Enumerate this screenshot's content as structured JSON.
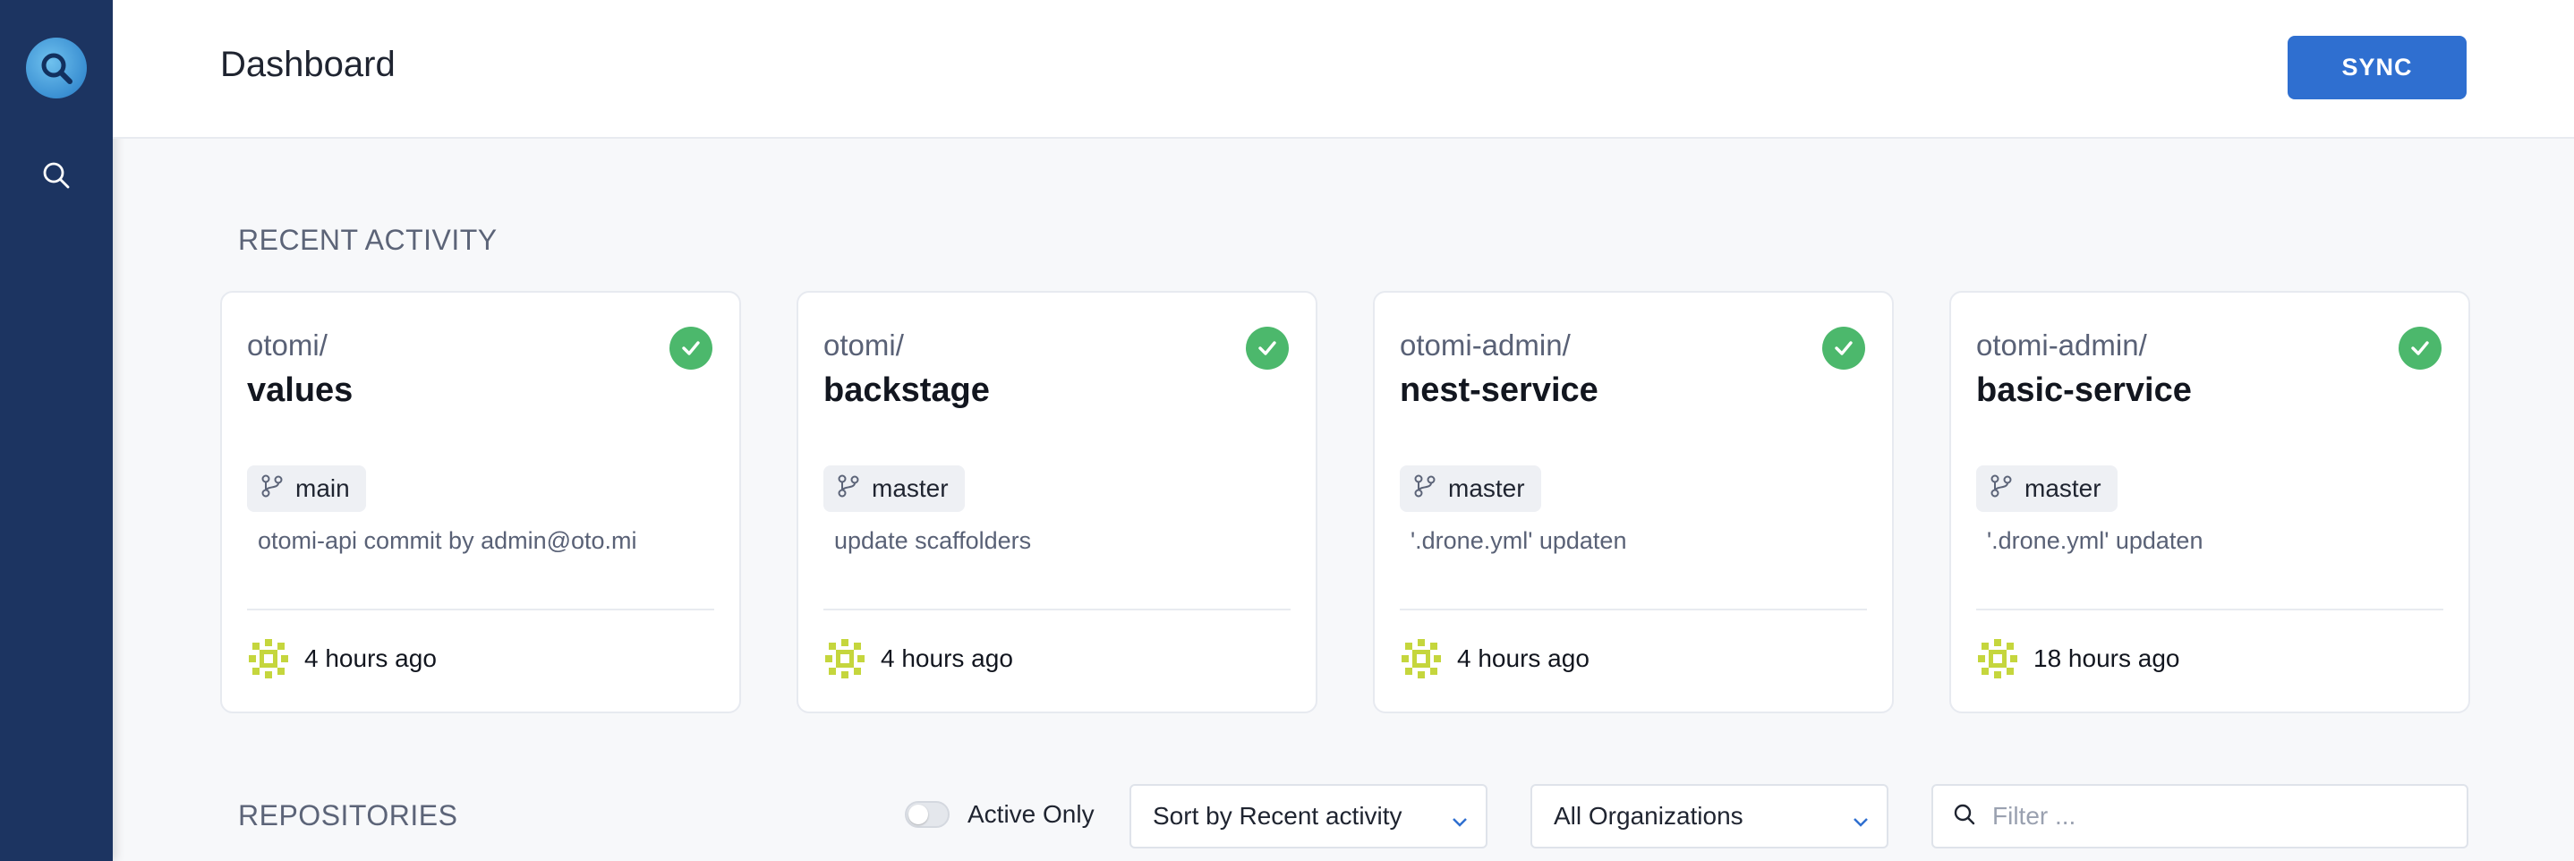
{
  "header": {
    "title": "Dashboard",
    "sync_label": "SYNC"
  },
  "sidebar": {
    "logo_icon": "logo-icon",
    "search_icon": "search-icon"
  },
  "recent_activity": {
    "title": "RECENT ACTIVITY",
    "cards": [
      {
        "org": "otomi/",
        "repo": "values",
        "branch": "main",
        "message": "otomi-api commit by admin@oto.mi",
        "time": "4 hours ago",
        "status": "success"
      },
      {
        "org": "otomi/",
        "repo": "backstage",
        "branch": "master",
        "message": "update scaffolders",
        "time": "4 hours ago",
        "status": "success"
      },
      {
        "org": "otomi-admin/",
        "repo": "nest-service",
        "branch": "master",
        "message": "'.drone.yml' updaten",
        "time": "4 hours ago",
        "status": "success"
      },
      {
        "org": "otomi-admin/",
        "repo": "basic-service",
        "branch": "master",
        "message": "'.drone.yml' updaten",
        "time": "18 hours ago",
        "status": "success"
      }
    ]
  },
  "repositories": {
    "title": "REPOSITORIES",
    "active_only_label": "Active Only",
    "sort_value": "Sort by Recent activity",
    "org_value": "All Organizations",
    "filter_placeholder": "Filter ..."
  },
  "colors": {
    "sidebar": "#1c3461",
    "accent": "#2f6fd0",
    "success": "#4cb86c"
  }
}
